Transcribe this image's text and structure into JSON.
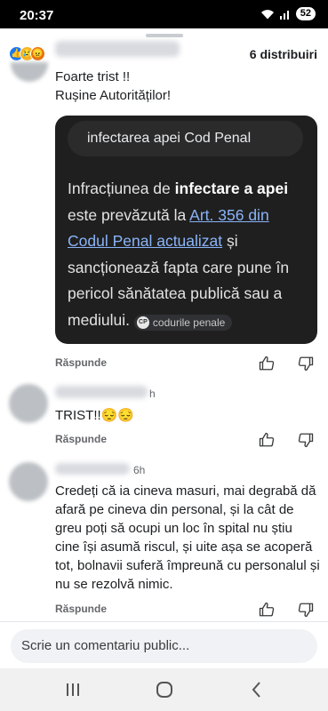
{
  "status_bar": {
    "time": "20:37",
    "battery": "52"
  },
  "header": {
    "shares": "6 distribuiri"
  },
  "comments": [
    {
      "text_line1": "Foarte trist  !!",
      "text_line2": "Rușine Autorităților!"
    },
    {
      "text": "TRIST!!😔😔",
      "time": "h",
      "reply_label": "Răspunde"
    },
    {
      "time": "6h",
      "text": "Credeți că ia cineva masuri, mai degrabă dă afară pe cineva din personal, și la cât de greu poți să ocupi un loc în spital nu știu cine își asumă riscul, și uite așa se acoperă tot, bolnavii suferă împreună cu personalul și nu se rezolvă nimic.",
      "reply_label": "Răspunde"
    }
  ],
  "search_card": {
    "query": "infectarea apei Cod Penal",
    "body_prefix": "Infracțiunea de ",
    "body_bold": "infectare a apei",
    "body_middle": " este prevăzută la ",
    "body_link": "Art. 356 din Codul Penal actualizat",
    "body_suffix": " și sancționează fapta care pune în pericol sănătatea publică sau a mediului.",
    "source_logo": "CP",
    "source": "codurile penale"
  },
  "first_reply_label": "Răspunde",
  "composer": {
    "placeholder": "Scrie un comentariu public..."
  }
}
